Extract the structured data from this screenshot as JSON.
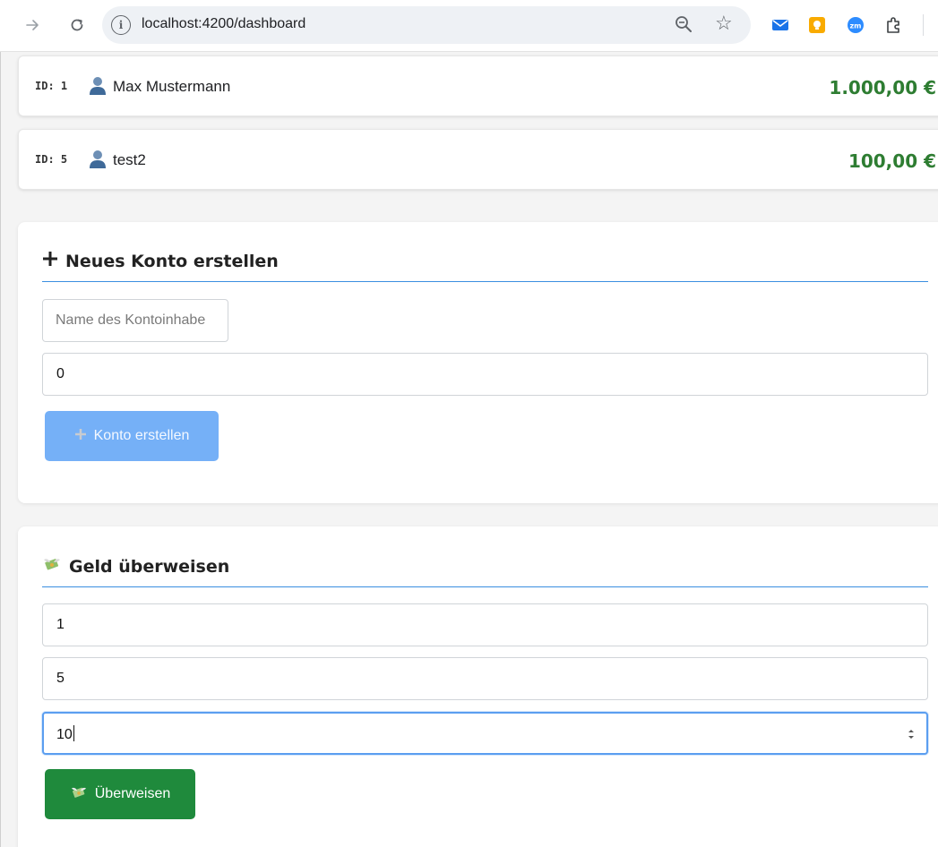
{
  "browser": {
    "url": "localhost:4200/dashboard",
    "icons": [
      "back-arrow-icon",
      "reload-icon",
      "info-icon",
      "zoom-icon",
      "star-icon",
      "mail-extension-icon",
      "yellow-extension-icon",
      "zoom-extension-icon",
      "puzzle-icon"
    ],
    "colors": {
      "mail": "#1a73e8",
      "yellow": "#f9ab00",
      "zoom": "#2d8cff"
    }
  },
  "accounts": [
    {
      "id_label": "ID: 1",
      "name": "Max Mustermann",
      "balance": "1.000,00 €"
    },
    {
      "id_label": "ID: 5",
      "name": "test2",
      "balance": "100,00 €"
    }
  ],
  "create_account": {
    "title": "Neues Konto erstellen",
    "title_icon": "plus-icon",
    "name_placeholder": "Name des Kontoinhabe",
    "initial_balance_value": "0",
    "submit_label": "Konto erstellen",
    "submit_color": "#75b0f7"
  },
  "transfer": {
    "title": "Geld überweisen",
    "title_icon": "money-wings-icon",
    "from_value": "1",
    "to_value": "5",
    "amount_value": "10",
    "submit_label": "Überweisen",
    "submit_color": "#1f8a3c"
  },
  "colors": {
    "balance_green": "#2e7d32",
    "rule_blue": "#3b8fe0",
    "focus_blue": "#5b9ef0"
  }
}
